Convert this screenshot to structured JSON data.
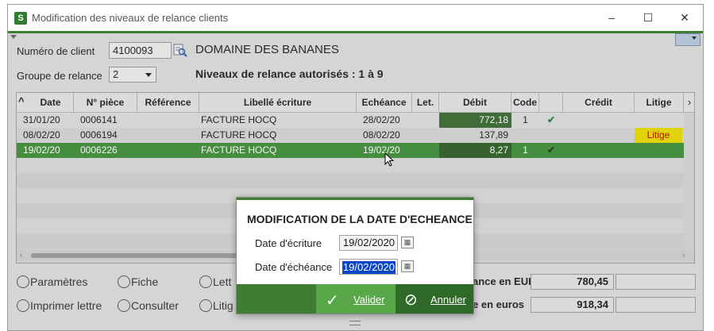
{
  "window": {
    "title": "Modification des niveaux de relance clients",
    "minimize_glyph": "–",
    "maximize_glyph": "☐",
    "close_glyph": "✕"
  },
  "form": {
    "client_label": "Numéro de client",
    "client_value": "4100093",
    "company_name": "DOMAINE DES BANANES",
    "group_label": "Groupe de relance",
    "group_value": "2",
    "levels_text": "Niveaux de relance autorisés : 1 à 9"
  },
  "table": {
    "headers": [
      "Date",
      "N° pièce",
      "Référence",
      "Libellé écriture",
      "Echéance",
      "Let.",
      "Débit",
      "Code",
      "",
      "Crédit",
      "Litige"
    ],
    "rows": [
      {
        "date": "31/01/20",
        "piece": "0006141",
        "reference": "",
        "libelle": "FACTURE HOCQ",
        "echeance": "28/02/20",
        "let": "",
        "debit": "772,18",
        "code": "1",
        "checked": true,
        "credit": "",
        "litige": ""
      },
      {
        "date": "08/02/20",
        "piece": "0006194",
        "reference": "",
        "libelle": "FACTURE HOCQ",
        "echeance": "08/02/20",
        "let": "",
        "debit": "137,89",
        "code": "",
        "checked": false,
        "credit": "",
        "litige": "Litige"
      },
      {
        "date": "19/02/20",
        "piece": "0006226",
        "reference": "",
        "libelle": "FACTURE HOCQ",
        "echeance": "19/02/20",
        "let": "",
        "debit": "8,27",
        "code": "1",
        "checked": true,
        "credit": "",
        "litige": ""
      }
    ]
  },
  "actions": {
    "parametres": "Paramètres",
    "fiche": "Fiche",
    "lettre_partial": "Lett",
    "imprimer": "Imprimer lettre",
    "consulter": "Consulter",
    "litige_partial": "Litig"
  },
  "totals": {
    "label_1": "ance en EUR",
    "value_1": "780,45",
    "label_2": "e en euros",
    "value_2": "918,34"
  },
  "modal": {
    "title": "MODIFICATION DE LA DATE D'ECHEANCE",
    "date_ecriture_label": "Date d'écriture",
    "date_ecriture_value": "19/02/2020",
    "date_echeance_label": "Date d'échéance",
    "date_echeance_value": "19/02/2020",
    "valider": "Valider",
    "annuler": "Annuler"
  },
  "colors": {
    "accent": "#3f7d33",
    "selected_row": "#3f8f3a",
    "debit_cell": "#3a6a30",
    "litige_bg": "#e8d800",
    "litige_text": "#c00000"
  }
}
